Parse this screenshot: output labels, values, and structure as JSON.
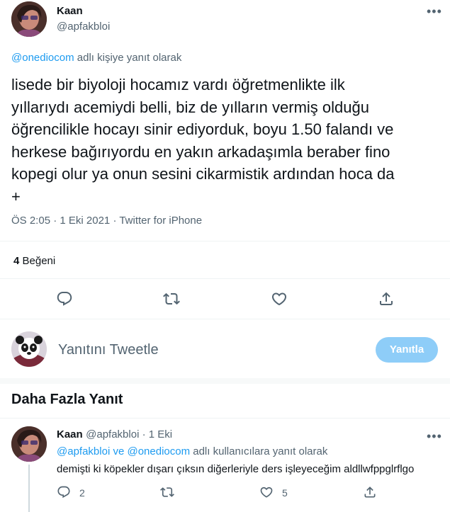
{
  "tweet": {
    "author_name": "Kaan",
    "author_handle": "@apfakbloi",
    "more_icon": "more-dots-icon",
    "replying_link": "@onediocom",
    "replying_suffix": " adlı kişiye yanıt olarak",
    "text": "lisede bir biyoloji hocamız vardı öğretmenlikte ilk\nyıllarıydı acemiydi belli, biz de yılların vermiş olduğu\nöğrencilikle hocayı sinir ediyorduk, boyu 1.50 falandı ve\nherkese bağırıyordu en yakın arkadaşımla beraber fino\nkopegi olur ya onun sesini cikarmistik ardından hoca da\n+",
    "time": "ÖS 2:05",
    "date": "1 Eki 2021",
    "source": "Twitter for iPhone",
    "sep": " · ",
    "like_count": "4",
    "like_label": " Beğeni",
    "actions": [
      "reply-icon",
      "retweet-icon",
      "like-icon",
      "share-icon"
    ]
  },
  "composer": {
    "placeholder": "Yanıtını Tweetle",
    "button_label": "Yanıtla",
    "button_color": "#8ecdf8"
  },
  "more_replies": {
    "title": "Daha Fazla Yanıt"
  },
  "reply": {
    "author_name": "Kaan",
    "author_handle": "@apfakbloi",
    "sep": " · ",
    "date": "1 Eki",
    "replying_link_1": "@apfakbloi",
    "replying_mid": " ve ",
    "replying_link_2": "@onediocom",
    "replying_suffix": " adlı kullanıcılara yanıt olarak",
    "text": "demişti ki köpekler dışarı çıksın diğerleriyle ders işleyeceğim aldllwfppglrflgo",
    "reply_count": "2",
    "like_count": "5"
  },
  "colors": {
    "accent": "#1d9bf0",
    "muted": "#536471",
    "text": "#0f1419",
    "divider": "#eff3f4"
  }
}
